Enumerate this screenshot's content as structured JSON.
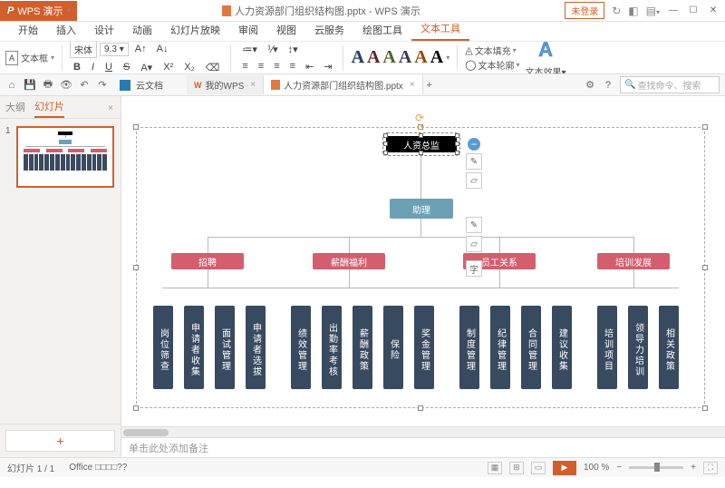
{
  "app": {
    "name": "WPS 演示",
    "doc_title": "人力资源部门组织结构图.pptx - WPS 演示",
    "unlogin": "未登录"
  },
  "menu": {
    "items": [
      "开始",
      "插入",
      "设计",
      "动画",
      "幻灯片放映",
      "审阅",
      "视图",
      "云服务",
      "绘图工具",
      "文本工具"
    ],
    "active_index": 9
  },
  "ribbon": {
    "textbox_label": "文本框",
    "font_name": "宋体",
    "font_size": "9.3",
    "fill_label": "文本填充",
    "outline_label": "文本轮廓",
    "effect_label": "文本效果"
  },
  "quickbar": {
    "cloud_doc": "云文档",
    "tabs": [
      {
        "label": "我的WPS",
        "active": false
      },
      {
        "label": "人力资源部门组织结构图.pptx",
        "active": true
      }
    ],
    "search_placeholder": "查找命令、搜索"
  },
  "sidepanel": {
    "outline_tab": "大纲",
    "slides_tab": "幻灯片",
    "thumb_num": "1",
    "add": "+"
  },
  "org": {
    "root": "人资总监",
    "assistant": "助理",
    "level2": [
      "招聘",
      "薪酬福利",
      "员工关系",
      "培训发展"
    ],
    "leaves": [
      "岗位筛查",
      "申请者收集",
      "面试管理",
      "申请者选拔",
      "绩效管理",
      "出勤率考核",
      "薪酬政策",
      "保险",
      "奖金管理",
      "制度管理",
      "纪律管理",
      "合同管理",
      "建议收集",
      "培训项目",
      "领导力培训",
      "相关政策"
    ]
  },
  "float_char": "字",
  "notes_placeholder": "单击此处添加备注",
  "status": {
    "slide_info": "幻灯片 1 / 1",
    "office_hint": "Office □□□□??",
    "zoom": "100 %"
  }
}
